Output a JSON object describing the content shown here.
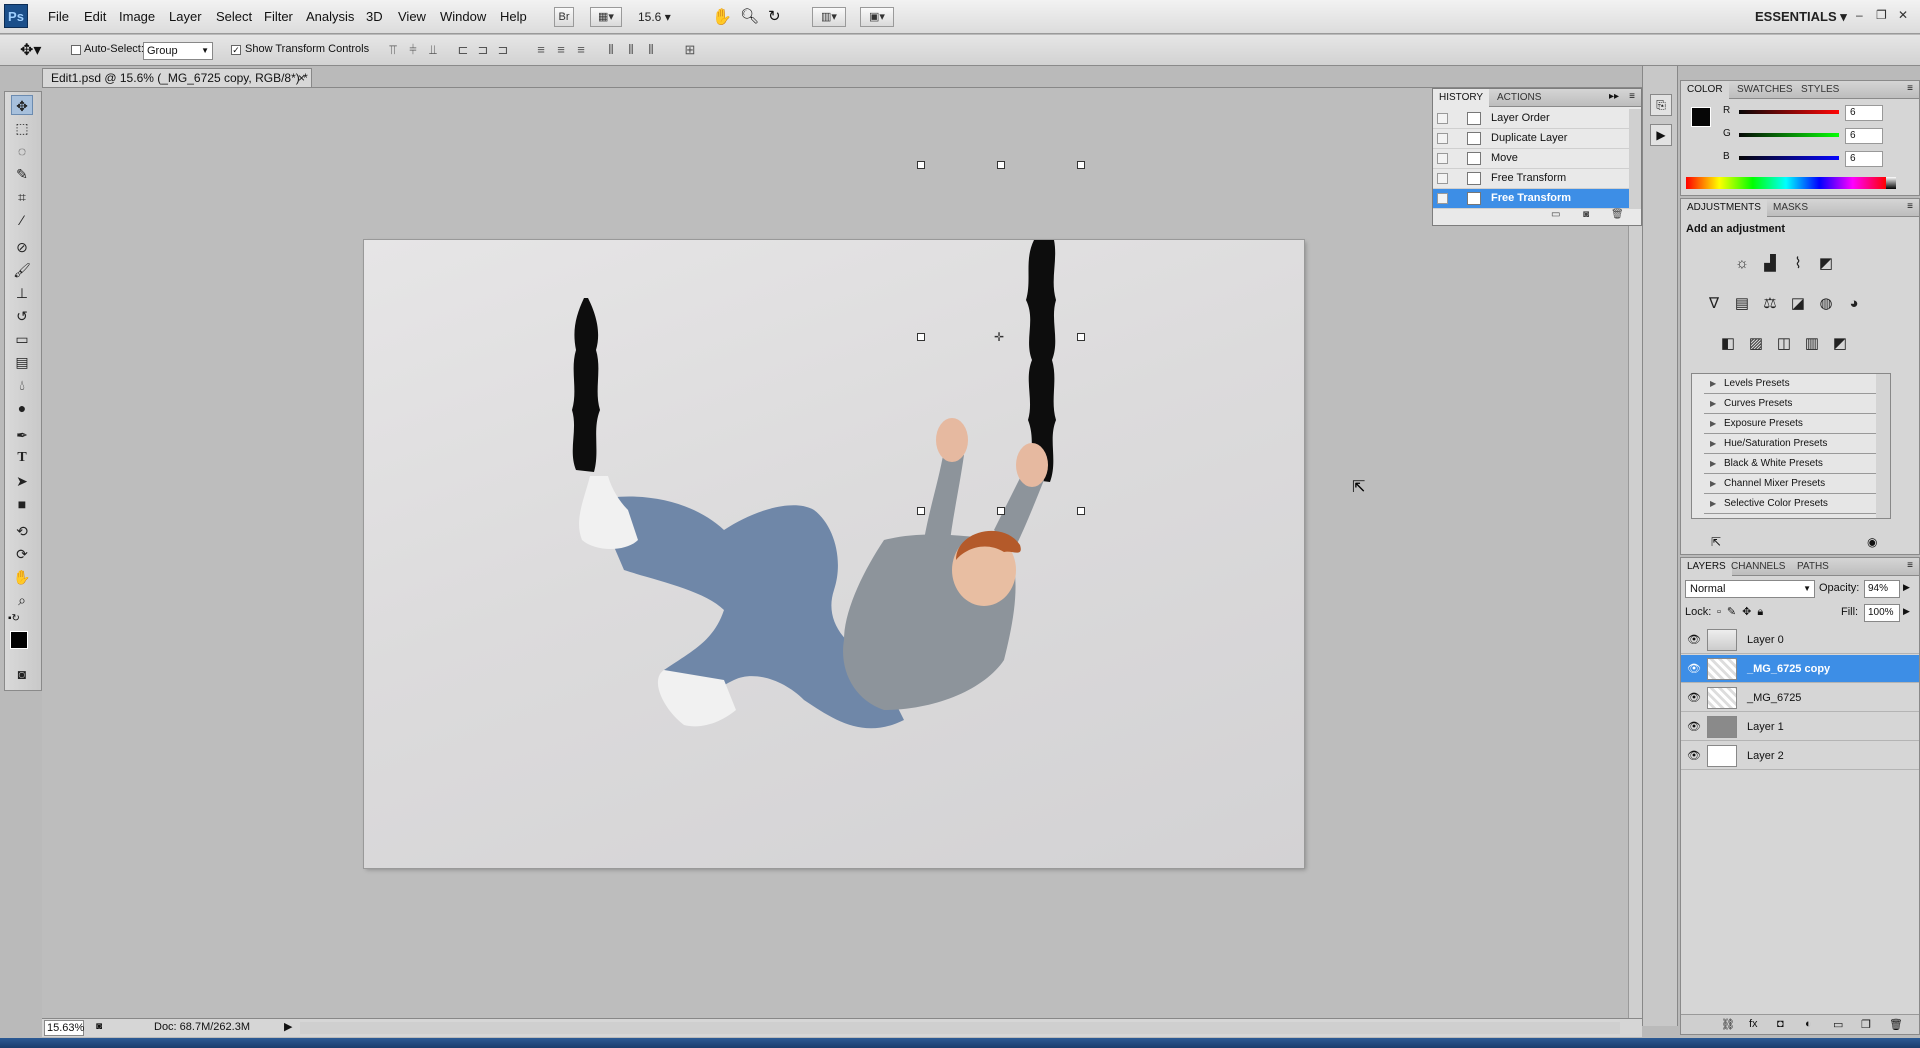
{
  "menubar": {
    "logo": "Ps",
    "items": [
      "File",
      "Edit",
      "Image",
      "Layer",
      "Select",
      "Filter",
      "Analysis",
      "3D",
      "View",
      "Window",
      "Help"
    ],
    "bridge_label": "Br",
    "zoom_value": "15.6",
    "workspace": "ESSENTIALS"
  },
  "options": {
    "auto_select_label": "Auto-Select:",
    "auto_select_value": "Group",
    "show_transform_label": "Show Transform Controls"
  },
  "document": {
    "tab_title": "Edit1.psd @ 15.6% (_MG_6725 copy, RGB/8*) *",
    "close_symbol": "×"
  },
  "status": {
    "zoom": "15.63%",
    "doc_info": "Doc: 68.7M/262.3M"
  },
  "history": {
    "tabs": [
      "HISTORY",
      "ACTIONS"
    ],
    "items": [
      "Layer Order",
      "Duplicate Layer",
      "Move",
      "Free Transform",
      "Free Transform"
    ],
    "selected_index": 4
  },
  "color": {
    "tabs": [
      "COLOR",
      "SWATCHES",
      "STYLES"
    ],
    "channels": [
      {
        "label": "R",
        "value": "6",
        "color": "#e01010"
      },
      {
        "label": "G",
        "value": "6",
        "color": "#10c010"
      },
      {
        "label": "B",
        "value": "6",
        "color": "#1020e0"
      }
    ]
  },
  "adjustments": {
    "tabs": [
      "ADJUSTMENTS",
      "MASKS"
    ],
    "heading": "Add an adjustment",
    "presets": [
      "Levels Presets",
      "Curves Presets",
      "Exposure Presets",
      "Hue/Saturation Presets",
      "Black & White Presets",
      "Channel Mixer Presets",
      "Selective Color Presets"
    ]
  },
  "layers": {
    "tabs": [
      "LAYERS",
      "CHANNELS",
      "PATHS"
    ],
    "blend_mode": "Normal",
    "opacity_label": "Opacity:",
    "opacity_value": "94%",
    "lock_label": "Lock:",
    "fill_label": "Fill:",
    "fill_value": "100%",
    "items": [
      "Layer 0",
      "_MG_6725 copy",
      "_MG_6725",
      "Layer 1",
      "Layer 2"
    ],
    "selected_index": 1
  }
}
